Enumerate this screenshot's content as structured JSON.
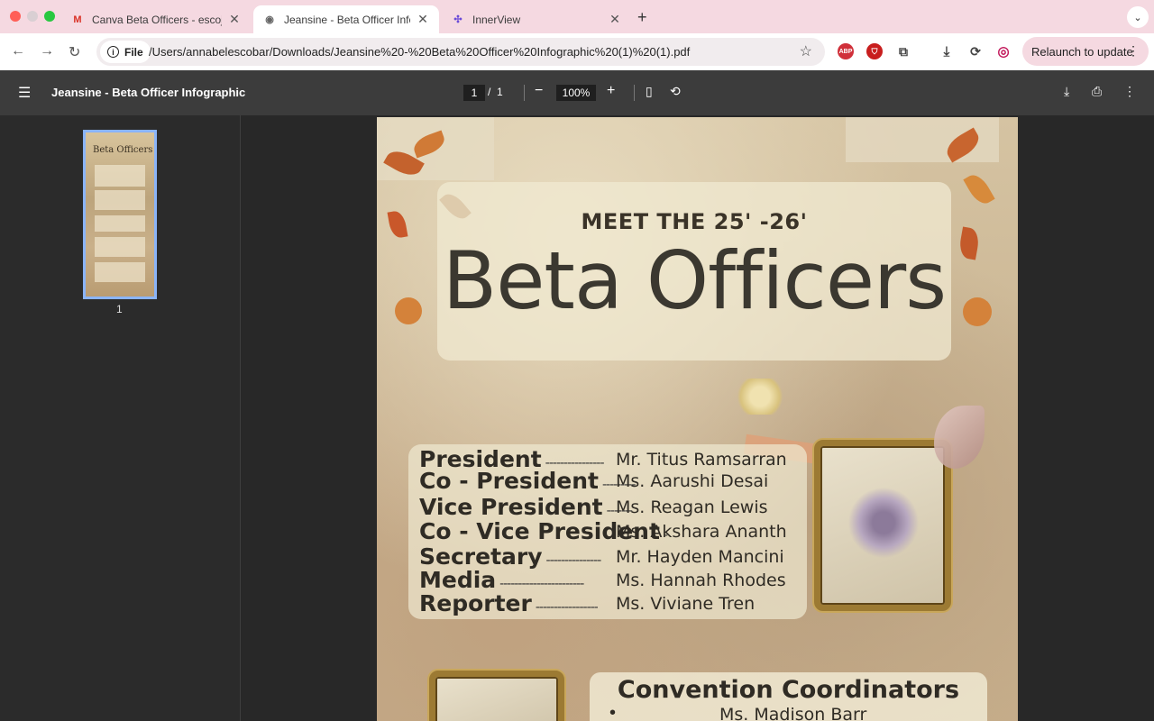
{
  "tabs": [
    {
      "title": "Canva Beta Officers - escojat",
      "icon": "gmail-icon",
      "active": false
    },
    {
      "title": "Jeansine - Beta Officer Infogr",
      "icon": "globe-icon",
      "active": true
    },
    {
      "title": "InnerView",
      "icon": "innerview-icon",
      "active": false
    }
  ],
  "toolbar": {
    "file_chip": "File",
    "url": "/Users/annabelescobar/Downloads/Jeansine%20-%20Beta%20Officer%20Infographic%20(1)%20(1).pdf",
    "relaunch_label": "Relaunch to update",
    "abp_label": "ABP"
  },
  "pdf": {
    "title": "Jeansine - Beta Officer Infographic",
    "current_page": "1",
    "page_separator": "/",
    "total_pages": "1",
    "zoom": "100%",
    "thumbnail_number": "1",
    "thumbnail_title": "Beta Officers"
  },
  "document": {
    "subtitle": "MEET THE 25' -26'",
    "title": "Beta Officers",
    "officers": [
      {
        "role": "President",
        "dashes": "----------------",
        "name": "Mr. Titus Ramsarran"
      },
      {
        "role": "Co - President",
        "dashes": "---------",
        "name": "Ms. Aarushi Desai"
      },
      {
        "role": "Vice President",
        "dashes": "-------",
        "name": "Ms. Reagan Lewis"
      },
      {
        "role": "Co - Vice President",
        "dashes": "-",
        "name": "Ms. Akshara Ananth"
      },
      {
        "role": "Secretary",
        "dashes": "---------------",
        "name": "Mr. Hayden Mancini"
      },
      {
        "role": "Media",
        "dashes": "-----------------------",
        "name": "Ms. Hannah Rhodes"
      },
      {
        "role": "Reporter",
        "dashes": "-----------------",
        "name": "Ms. Viviane Tren"
      }
    ],
    "coordinators_title": "Convention Coordinators",
    "coordinators": [
      "Ms. Madison Barr"
    ]
  },
  "colors": {
    "tab_strip": "#f5d9e1",
    "pdf_toolbar": "#3c3c3c",
    "viewer_bg": "#282828",
    "thumb_highlight": "#8ab4f8"
  }
}
